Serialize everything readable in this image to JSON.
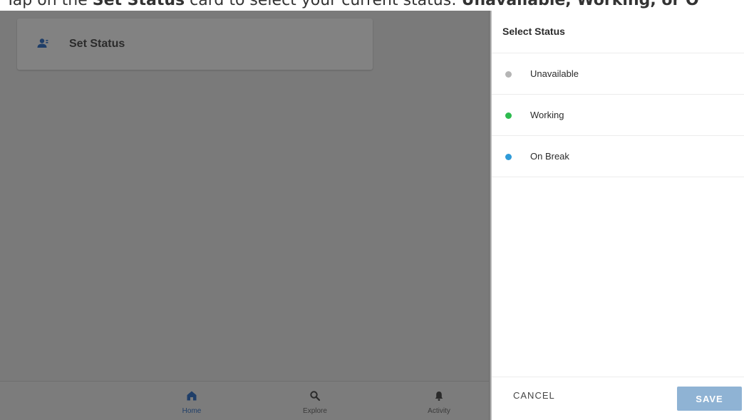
{
  "instruction": {
    "prefix": "Tap on the ",
    "card_name": "Set Status",
    "middle": " card to select your current status: ",
    "options": "Unavailable, Working, or O"
  },
  "card": {
    "title": "Set Status",
    "icon": "person-status-icon"
  },
  "bottom_nav": {
    "items": [
      {
        "label": "Home",
        "icon": "home-icon",
        "active": true
      },
      {
        "label": "Explore",
        "icon": "search-icon",
        "active": false
      },
      {
        "label": "Activity",
        "icon": "bell-icon",
        "active": false
      }
    ]
  },
  "panel": {
    "title": "Select Status",
    "options": [
      {
        "label": "Unavailable",
        "color": "#b5b5b5"
      },
      {
        "label": "Working",
        "color": "#2dbb4f"
      },
      {
        "label": "On Break",
        "color": "#2f9bd8"
      }
    ],
    "cancel_label": "CANCEL",
    "save_label": "SAVE"
  },
  "colors": {
    "overlay": "#7a7a7a",
    "nav_active": "#1f3e68",
    "save_button": "#8fb3d4"
  }
}
